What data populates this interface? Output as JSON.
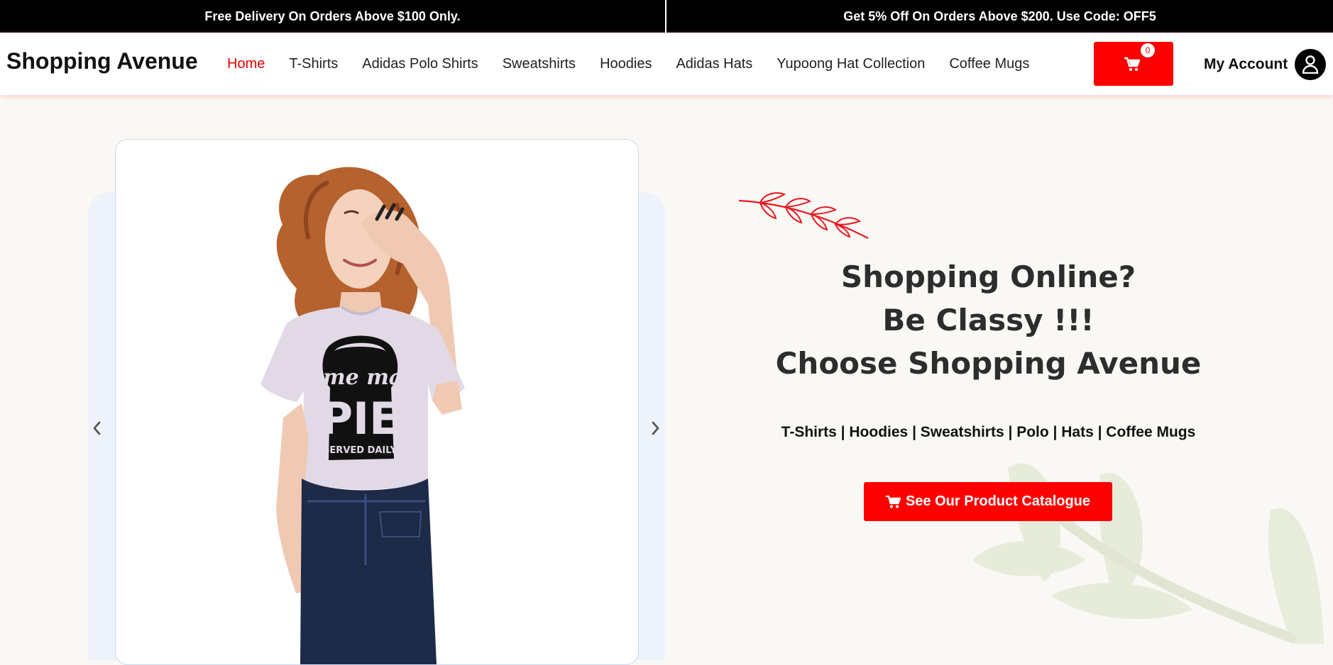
{
  "announcements": {
    "left": "Free Delivery On Orders Above $100 Only.",
    "right": "Get 5% Off On Orders Above $200. Use Code: OFF5"
  },
  "header": {
    "brand": "Shopping Avenue",
    "nav": [
      {
        "label": "Home",
        "active": true
      },
      {
        "label": "T-Shirts"
      },
      {
        "label": "Adidas Polo Shirts"
      },
      {
        "label": "Sweatshirts"
      },
      {
        "label": "Hoodies"
      },
      {
        "label": "Adidas Hats"
      },
      {
        "label": "Yupoong Hat Collection"
      },
      {
        "label": "Coffee Mugs"
      }
    ],
    "cart_count": "0",
    "account_label": "My Account"
  },
  "hero": {
    "headline_lines": [
      "Shopping Online?",
      "Be Classy !!!",
      "Choose Shopping Avenue"
    ],
    "categories_line": "T-Shirts | Hoodies | Sweatshirts | Polo | Hats | Coffee Mugs",
    "cta_label": "See Our Product Catalogue",
    "slide_print_text": [
      "Home made",
      "PIE",
      "SERVED DAILY"
    ]
  },
  "icons": {
    "cart": "cart-icon",
    "account": "user-icon",
    "prev": "chevron-left-icon",
    "next": "chevron-right-icon",
    "cta": "cart-icon"
  },
  "colors": {
    "accent": "#ff0000",
    "topbar": "#000000",
    "carousel_bg": "#eef2fa",
    "headline": "#2d2d2d",
    "page_bg": "#faf8f5"
  }
}
